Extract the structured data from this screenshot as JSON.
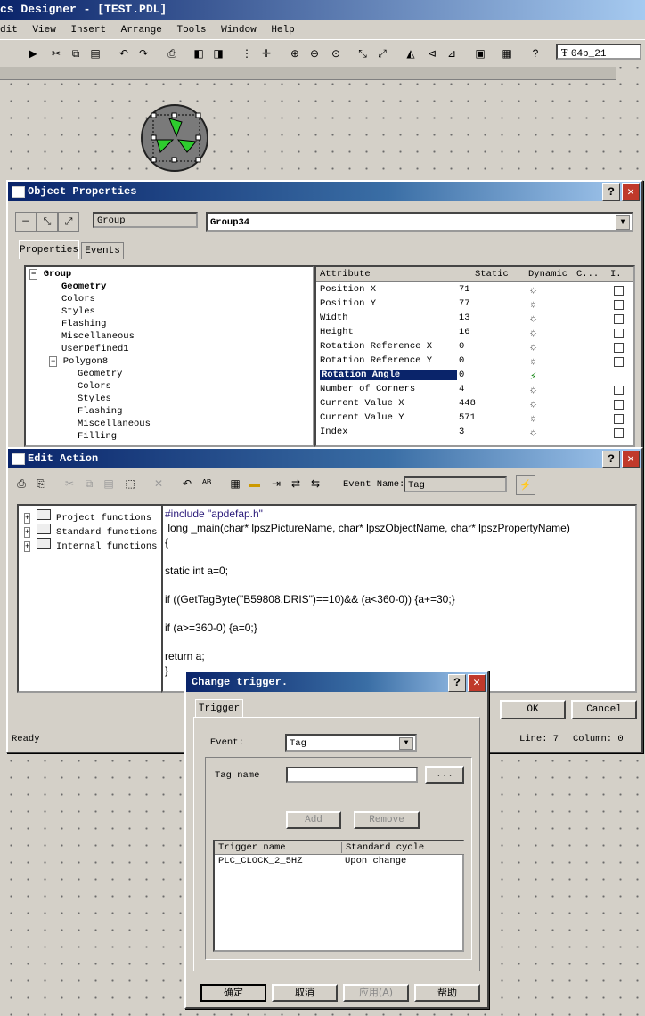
{
  "app": {
    "title": "cs Designer - [TEST.PDL]"
  },
  "menu": [
    "dit",
    "View",
    "Insert",
    "Arrange",
    "Tools",
    "Window",
    "Help"
  ],
  "toolbar": {
    "font_combo": "04b_21"
  },
  "object_properties": {
    "title": "Object Properties",
    "type_field": "Group",
    "name_combo": "Group34",
    "tabs": [
      "Properties",
      "Events"
    ],
    "tree": [
      "Group",
      "Geometry",
      "Colors",
      "Styles",
      "Flashing",
      "Miscellaneous",
      "UserDefined1",
      "Polygon8",
      "Geometry",
      "Colors",
      "Styles",
      "Flashing",
      "Miscellaneous",
      "Filling"
    ],
    "columns": [
      "Attribute",
      "Static",
      "Dynamic",
      "C...",
      "I."
    ],
    "rows": [
      {
        "attr": "Position X",
        "static": "71"
      },
      {
        "attr": "Position Y",
        "static": "77"
      },
      {
        "attr": "Width",
        "static": "13"
      },
      {
        "attr": "Height",
        "static": "16"
      },
      {
        "attr": "Rotation Reference X",
        "static": "0"
      },
      {
        "attr": "Rotation Reference Y",
        "static": "0"
      },
      {
        "attr": "Rotation Angle",
        "static": "0"
      },
      {
        "attr": "Number of Corners",
        "static": "4"
      },
      {
        "attr": "Current Value X",
        "static": "448"
      },
      {
        "attr": "Current Value Y",
        "static": "571"
      },
      {
        "attr": "Index",
        "static": "3"
      }
    ]
  },
  "edit_action": {
    "title": "Edit Action",
    "event_name_label": "Event Name:",
    "event_name_value": "Tag",
    "tree": [
      "Project functions",
      "Standard functions",
      "Internal functions"
    ],
    "code": [
      "#include \"apdefap.h\"",
      " long _main(char* lpszPictureName, char* lpszObjectName, char* lpszPropertyName)",
      "{",
      "",
      "static int a=0;",
      "",
      "if ((GetTagByte(\"B59808.DRIS\")==10)&& (a<360-0)) {a+=30;}",
      "",
      "if (a>=360-0) {a=0;}",
      "",
      "return a;",
      "}"
    ],
    "ok": "OK",
    "cancel": "Cancel",
    "status": "Ready",
    "line": "Line: 7",
    "column": "Column: 0"
  },
  "change_trigger": {
    "title": "Change trigger.",
    "tab": "Trigger",
    "event_label": "Event:",
    "event_value": "Tag",
    "tag_name_label": "Tag name",
    "tag_name_value": "",
    "browse": "...",
    "add": "Add",
    "remove": "Remove",
    "columns": [
      "Trigger name",
      "Standard cycle"
    ],
    "rows": [
      {
        "name": "PLC_CLOCK_2_5HZ",
        "cycle": "Upon change"
      }
    ],
    "confirm": "确定",
    "cancel": "取消",
    "apply": "应用(A)",
    "help": "帮助"
  }
}
